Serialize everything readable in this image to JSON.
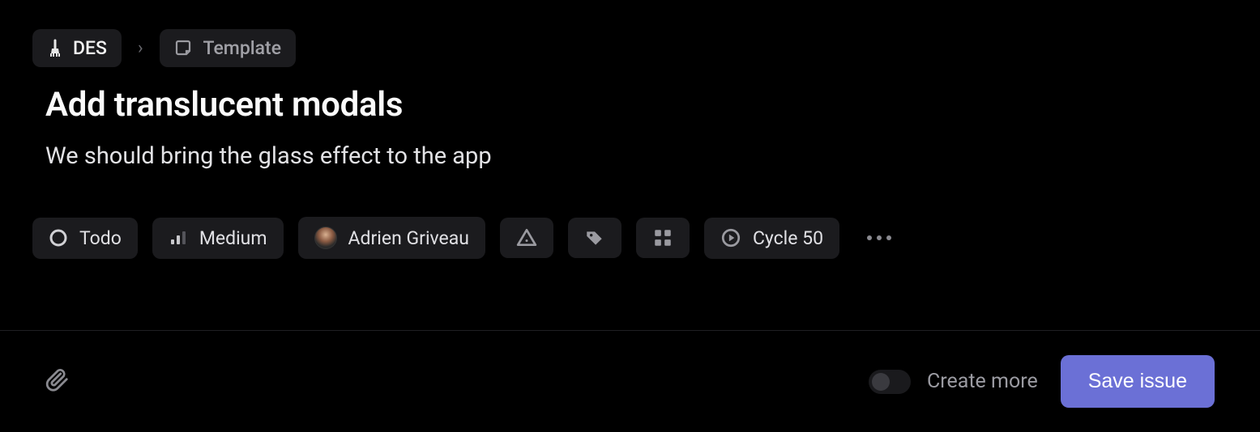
{
  "breadcrumb": {
    "project": "DES",
    "template": "Template"
  },
  "issue": {
    "title": "Add translucent modals",
    "description": "We should bring the glass effect to the app"
  },
  "pills": {
    "status": "Todo",
    "priority": "Medium",
    "assignee": "Adrien Griveau",
    "cycle": "Cycle 50"
  },
  "footer": {
    "create_more_label": "Create more",
    "save_label": "Save issue"
  }
}
